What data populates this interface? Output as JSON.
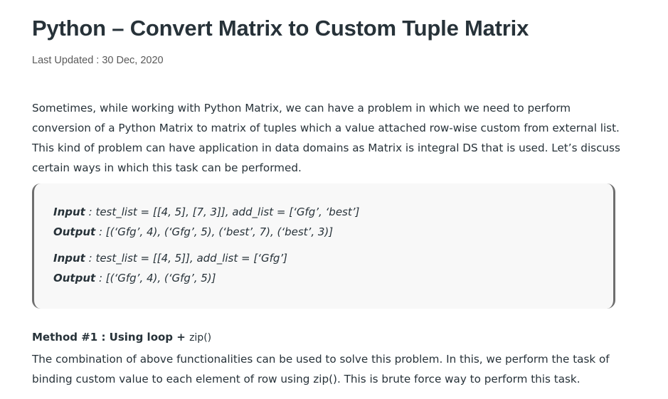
{
  "article": {
    "title": "Python – Convert Matrix to Custom Tuple Matrix",
    "last_updated": "Last Updated : 30 Dec, 2020",
    "intro": "Sometimes, while working with Python Matrix, we can have a problem in which we need to perform conversion of a Python Matrix to matrix of tuples which a value attached row-wise custom from external list. This kind of problem can have application in data domains as Matrix is integral DS that is used. Let’s discuss certain ways in which this task can be performed."
  },
  "examples": [
    {
      "input_label": "Input",
      "input_value": " : test_list = [[4, 5], [7, 3]], add_list = [‘Gfg’, ‘best’]",
      "output_label": "Output",
      "output_value": " : [(‘Gfg’, 4), (‘Gfg’, 5), (‘best’, 7), (‘best’, 3)]"
    },
    {
      "input_label": "Input",
      "input_value": " : test_list = [[4, 5]], add_list = [‘Gfg’]",
      "output_label": "Output",
      "output_value": " : [(‘Gfg’, 4), (‘Gfg’, 5)]"
    }
  ],
  "method1": {
    "heading": "Method #1 : Using loop + ",
    "heading_code": "zip()",
    "text": "The combination of above functionalities can be used to solve this problem. In this, we perform the task of binding custom value to each element of row using zip(). This is brute force way to perform this task."
  }
}
